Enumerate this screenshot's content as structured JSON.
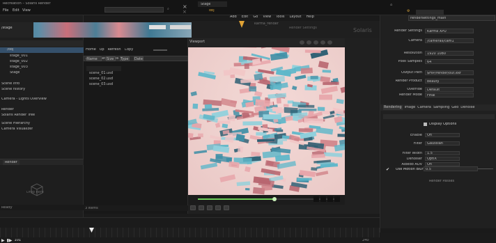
{
  "topbar": {
    "app_title": "Recreation – Solaris Render",
    "menu_left": [
      "File",
      "Edit",
      "View"
    ],
    "stage_tab": "Stage",
    "stage_path": "obj",
    "net_menu": [
      "Add",
      "Edit",
      "Go",
      "View",
      "Tools",
      "Layout",
      "Help"
    ]
  },
  "left_panel": {
    "path_label": "/stage",
    "tree": [
      {
        "label": "/obj",
        "selected": true
      },
      {
        "label": "stage_001"
      },
      {
        "label": "stage_002"
      },
      {
        "label": "stage_003"
      },
      {
        "label": "Stage"
      }
    ],
    "info_lines": [
      "Scene info",
      "Scene history",
      "Camera - Lights Overview",
      "Render",
      "Solaris Render Tree",
      "Scene Hierarchy",
      "Camera Visualizer",
      "Parameters",
      "Lighting"
    ],
    "bottom_tab": "Render",
    "empty_label": "Drop here",
    "footer": "Ready"
  },
  "file_panel": {
    "toolbar": [
      "Home",
      "Up",
      "Refresh",
      "Copy"
    ],
    "path": "/home/user/scenes",
    "columns": [
      "Name",
      "Size",
      "Type",
      "Date"
    ],
    "items": [
      "scene_01.usd",
      "scene_02.usd",
      "scene_03.usd"
    ],
    "status": "3 items"
  },
  "network": {
    "label": "Solaris",
    "node_label": "karma_render",
    "node_label2": "Render Settings"
  },
  "viewport": {
    "tab": "Viewport",
    "controls": [
      "Persp",
      "Cam",
      "Shade",
      "Lights",
      "Display"
    ],
    "bottom_bar": [
      "Frame",
      "Play",
      "Stop",
      "Loop",
      "Rec"
    ],
    "timeline_progress": 0.55
  },
  "params": {
    "node_name": "rendersettings_main",
    "rows": [
      {
        "label": "Render Settings",
        "value": "Karma XPU"
      },
      {
        "label": "Camera",
        "value": "/cameras/cam1"
      },
      {
        "label": "Resolution",
        "value": "1920 1080"
      },
      {
        "label": "Pixel Samples",
        "value": "64"
      },
      {
        "label": "Output Path",
        "value": "$HIP/render/out.exr"
      },
      {
        "label": "Render Product",
        "value": "beauty"
      },
      {
        "label": "Override",
        "value": "Default"
      },
      {
        "label": "Render Mode",
        "value": "Final"
      }
    ],
    "tabs": [
      "Rendering",
      "Image",
      "Camera",
      "Sampling",
      "Geo",
      "Denoise",
      "Output"
    ],
    "section_title": "Display Options",
    "section_rows": [
      {
        "label": "Enable",
        "value": "On"
      },
      {
        "label": "Filter",
        "value": "Gaussian"
      },
      {
        "label": "Filter Width",
        "value": "1.5"
      },
      {
        "label": "Denoiser",
        "value": "OptiX"
      },
      {
        "label": "Albedo AOV",
        "value": "On"
      }
    ],
    "check_label": "Use Motion Blur",
    "check_value": "0.5",
    "last_label": "Render Passes"
  },
  "timeline": {
    "frame": "101",
    "end": "240"
  }
}
